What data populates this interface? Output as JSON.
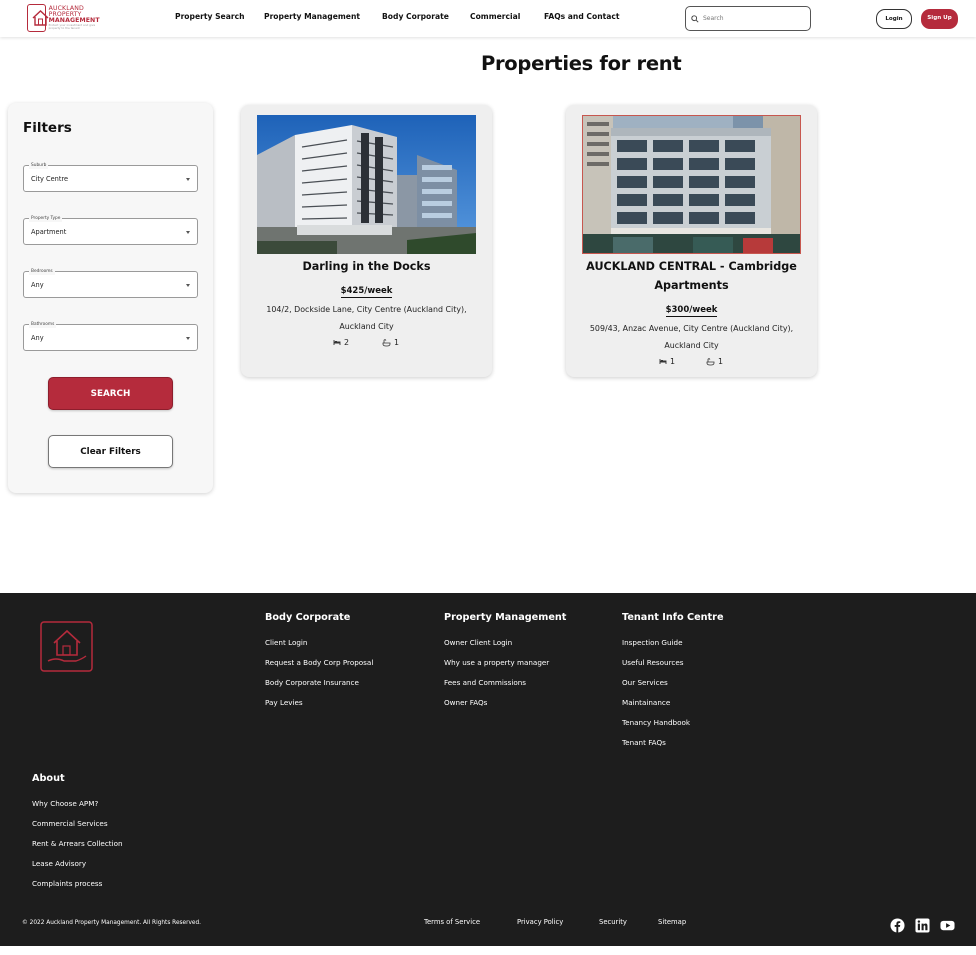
{
  "header": {
    "logo_line1": "AUCKLAND",
    "logo_line2": "PROPERTY",
    "logo_line3": "MANAGEMENT",
    "logo_tagline": "Protect your investment and give property to the tenant",
    "nav": [
      "Property Search",
      "Property Management",
      "Body Corporate",
      "Commercial",
      "FAQs and Contact"
    ],
    "search_placeholder": "Search",
    "login_label": "Login",
    "signup_label": "Sign Up"
  },
  "page_title": "Properties for rent",
  "filters": {
    "title": "Filters",
    "fields": [
      {
        "label": "Suburb",
        "value": "City Centre"
      },
      {
        "label": "Property Type",
        "value": "Apartment"
      },
      {
        "label": "Bedrooms",
        "value": "Any"
      },
      {
        "label": "Bathrooms",
        "value": "Any"
      }
    ],
    "search_label": "SEARCH",
    "clear_label": "Clear Filters"
  },
  "listings": [
    {
      "name_line1": "Darling in the Docks",
      "name_line2": "",
      "price": "$425/week",
      "addr_line1": "104/2, Dockside Lane, City Centre (Auckland City),",
      "addr_line2": "Auckland City",
      "bedrooms": "2",
      "bathrooms": "1"
    },
    {
      "name_line1": "AUCKLAND CENTRAL - Cambridge",
      "name_line2": "Apartments",
      "price": "$300/week",
      "addr_line1": "509/43, Anzac Avenue, City Centre (Auckland City),",
      "addr_line2": "Auckland City",
      "bedrooms": "1",
      "bathrooms": "1"
    }
  ],
  "footer": {
    "columns": [
      {
        "title": "Body Corporate",
        "links": [
          "Client Login",
          "Request a Body Corp Proposal",
          "Body Corporate Insurance",
          "Pay Levies"
        ]
      },
      {
        "title": "Property Management",
        "links": [
          "Owner Client Login",
          "Why use a property manager",
          "Fees and Commissions",
          "Owner FAQs"
        ]
      },
      {
        "title": "Tenant Info Centre",
        "links": [
          "Inspection Guide",
          "Useful Resources",
          "Our Services",
          "Maintainance",
          "Tenancy Handbook",
          "Tenant FAQs"
        ]
      },
      {
        "title": "About",
        "links": [
          "Why Choose APM?",
          "Commercial Services",
          "Rent & Arrears Collection",
          "Lease Advisory",
          "Complaints process"
        ]
      }
    ],
    "copyright": "© 2022 Auckland Property Management. All Rights Reserved.",
    "bottom_links": [
      "Terms of Service",
      "Privacy Policy",
      "Security",
      "Sitemap"
    ],
    "social": [
      "facebook-icon",
      "linkedin-icon",
      "youtube-icon"
    ]
  },
  "colors": {
    "brand": "#b52b3c",
    "footer_bg": "#1d1d1d"
  }
}
